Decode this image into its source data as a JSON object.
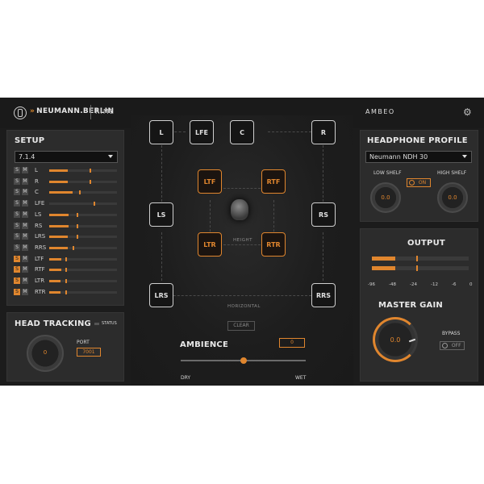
{
  "header": {
    "brand": "NEUMANN.BERLIN",
    "brand_prefix": "»",
    "product": "RIME",
    "right_brand": "AMBEO"
  },
  "setup": {
    "title": "SETUP",
    "format": "7.1.4",
    "channels": [
      {
        "name": "L",
        "solo": false,
        "level": 0.27,
        "tick": 0.6
      },
      {
        "name": "R",
        "solo": false,
        "level": 0.27,
        "tick": 0.6
      },
      {
        "name": "C",
        "solo": false,
        "level": 0.34,
        "tick": 0.44
      },
      {
        "name": "LFE",
        "solo": false,
        "level": 0.0,
        "tick": 0.66
      },
      {
        "name": "LS",
        "solo": false,
        "level": 0.29,
        "tick": 0.4
      },
      {
        "name": "RS",
        "solo": false,
        "level": 0.29,
        "tick": 0.4
      },
      {
        "name": "LRS",
        "solo": false,
        "level": 0.27,
        "tick": 0.4
      },
      {
        "name": "RRS",
        "solo": false,
        "level": 0.27,
        "tick": 0.34
      },
      {
        "name": "LTF",
        "solo": true,
        "level": 0.18,
        "tick": 0.24
      },
      {
        "name": "RTF",
        "solo": true,
        "level": 0.18,
        "tick": 0.24
      },
      {
        "name": "LTR",
        "solo": true,
        "level": 0.17,
        "tick": 0.24
      },
      {
        "name": "RTR",
        "solo": true,
        "level": 0.17,
        "tick": 0.24
      }
    ],
    "solo_label": "S",
    "mute_label": "M"
  },
  "head_tracking": {
    "title": "HEAD TRACKING",
    "status_label": "STATUS",
    "knob_value": "0",
    "port_label": "PORT",
    "port_value": "7001"
  },
  "room": {
    "floor_row_top": [
      "L",
      "LFE",
      "C",
      "R"
    ],
    "mid": [
      "LS",
      "RS"
    ],
    "bottom": [
      "LRS",
      "RRS"
    ],
    "height": [
      "LTF",
      "RTF",
      "LTR",
      "RTR"
    ],
    "height_label": "HEIGHT",
    "horizontal_label": "HORIZONTAL",
    "clear_label": "CLEAR"
  },
  "ambience": {
    "title": "AMBIENCE",
    "value": "0",
    "position": 0.5,
    "dry_label": "DRY",
    "wet_label": "WET"
  },
  "headphone_profile": {
    "title": "HEADPHONE PROFILE",
    "model": "Neumann NDH 30",
    "low_shelf_label": "LOW SHELF",
    "high_shelf_label": "HIGH SHELF",
    "low_shelf_value": "0.0",
    "high_shelf_value": "0.0",
    "on_label": "ON"
  },
  "output": {
    "title": "OUTPUT",
    "scale": [
      "-96",
      "-48",
      "-24",
      "-12",
      "-6",
      "0"
    ],
    "meter_levels": [
      0.24,
      0.24
    ],
    "meter_ticks": [
      0.46,
      0.46
    ]
  },
  "master_gain": {
    "title": "MASTER GAIN",
    "value": "0.0",
    "bypass_label": "BYPASS",
    "off_label": "OFF"
  },
  "colors": {
    "accent": "#e0862e",
    "panel": "#2c2c2c",
    "background": "#1c1c1c"
  }
}
